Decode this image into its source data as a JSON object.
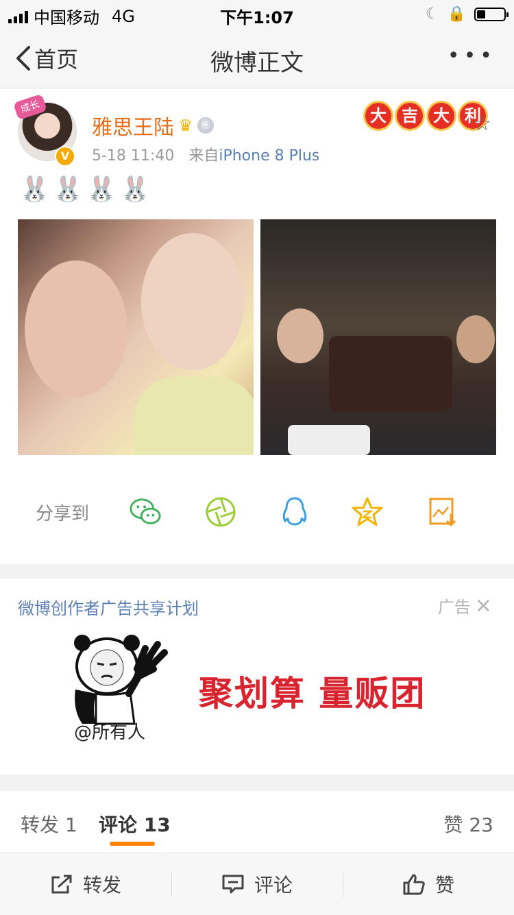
{
  "status_bar": {
    "carrier": "中国移动",
    "network": "4G",
    "time": "下午1:07"
  },
  "nav": {
    "back_label": "首页",
    "title": "微博正文",
    "more": "•••"
  },
  "post": {
    "username": "雅思王陆",
    "timestamp": "5-18 11:40",
    "source_prefix": "来自",
    "source": "iPhone 8 Plus",
    "luck_badge": [
      "大",
      "吉",
      "大",
      "利"
    ],
    "avatar_deco": "成长",
    "vip_badge": "V",
    "medal_text": "㊝",
    "emoji": "🐰🐰🐰🐰",
    "photos": [
      "photo-selfie",
      "photo-cafe"
    ]
  },
  "share": {
    "label": "分享到",
    "targets": [
      {
        "name": "wechat",
        "glyph": "💬",
        "color": "#3fb05b"
      },
      {
        "name": "moments",
        "glyph": "◎",
        "color": "#9acd32"
      },
      {
        "name": "qq",
        "glyph": "♟",
        "color": "#3a9ee3"
      },
      {
        "name": "qzone",
        "glyph": "☆",
        "color": "#f2b400"
      },
      {
        "name": "save-image",
        "glyph": "⬇",
        "color": "#f19a22"
      }
    ]
  },
  "ad": {
    "header": "微博创作者广告共享计划",
    "tag": "广告",
    "close": "×",
    "mention": "@所有人",
    "slogan": "聚划算  量贩团"
  },
  "tabs": {
    "repost": "转发 1",
    "comment": "评论 13",
    "like": "赞 23"
  },
  "bottom_bar": {
    "repost": "转发",
    "comment": "评论",
    "like": "赞"
  },
  "colors": {
    "accent": "#ff8200",
    "link": "#5a7fb0",
    "username": "#e86b12"
  }
}
